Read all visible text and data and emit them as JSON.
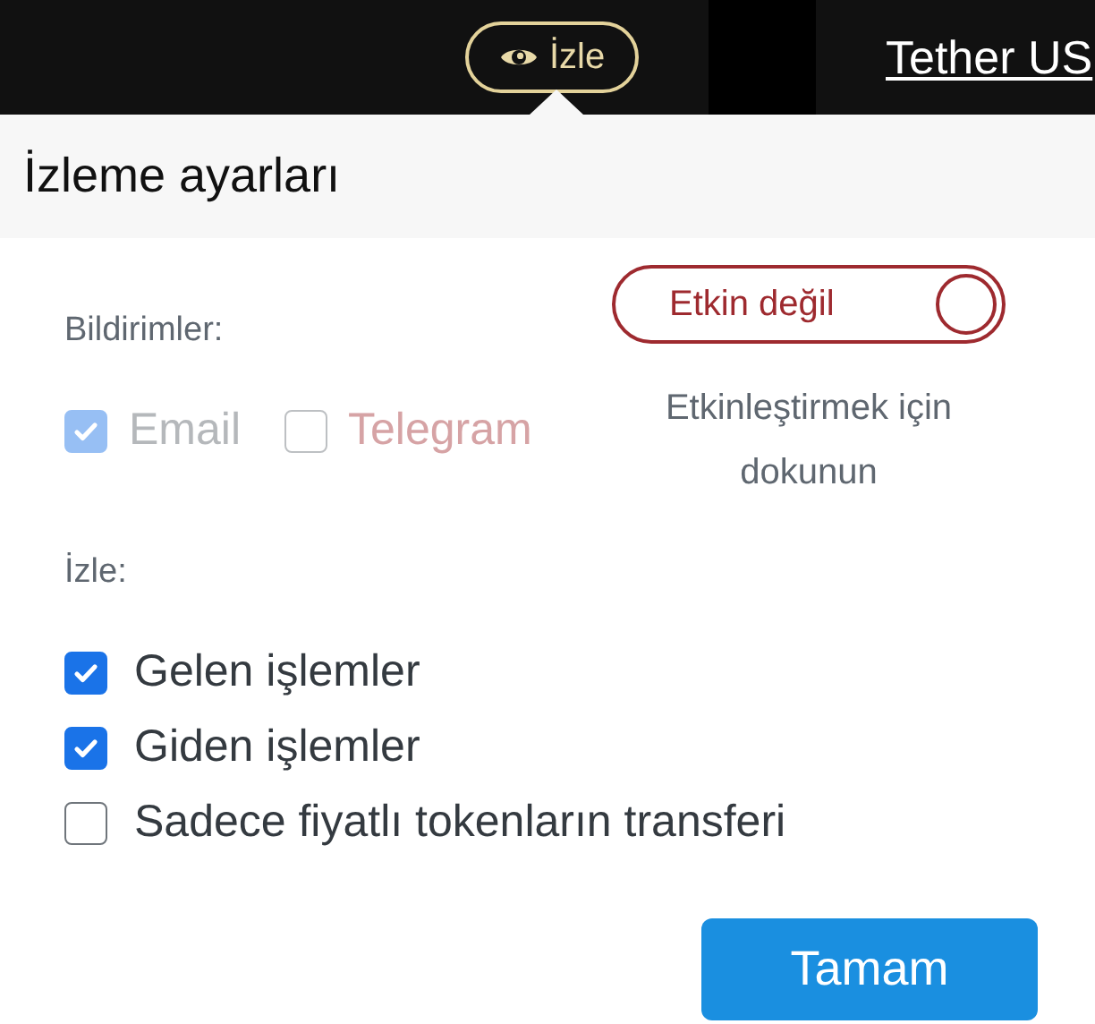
{
  "top_bar": {
    "watch_button": {
      "label": "İzle"
    },
    "link": "Tether US"
  },
  "popover": {
    "title": "İzleme ayarları",
    "notifications": {
      "label": "Bildirimler:",
      "channels": [
        {
          "label": "Email",
          "checked": true,
          "disabled": true
        },
        {
          "label": "Telegram",
          "checked": false,
          "disabled": true
        }
      ],
      "toggle": {
        "label": "Etkin değil",
        "on": false
      },
      "hint": "Etkinleştirmek için dokunun"
    },
    "watch": {
      "label": "İzle:",
      "options": [
        {
          "label": "Gelen işlemler",
          "checked": true
        },
        {
          "label": "Giden işlemler",
          "checked": true
        },
        {
          "label": "Sadece fiyatlı tokenların transferi",
          "checked": false
        }
      ]
    },
    "ok_button": "Tamam"
  }
}
